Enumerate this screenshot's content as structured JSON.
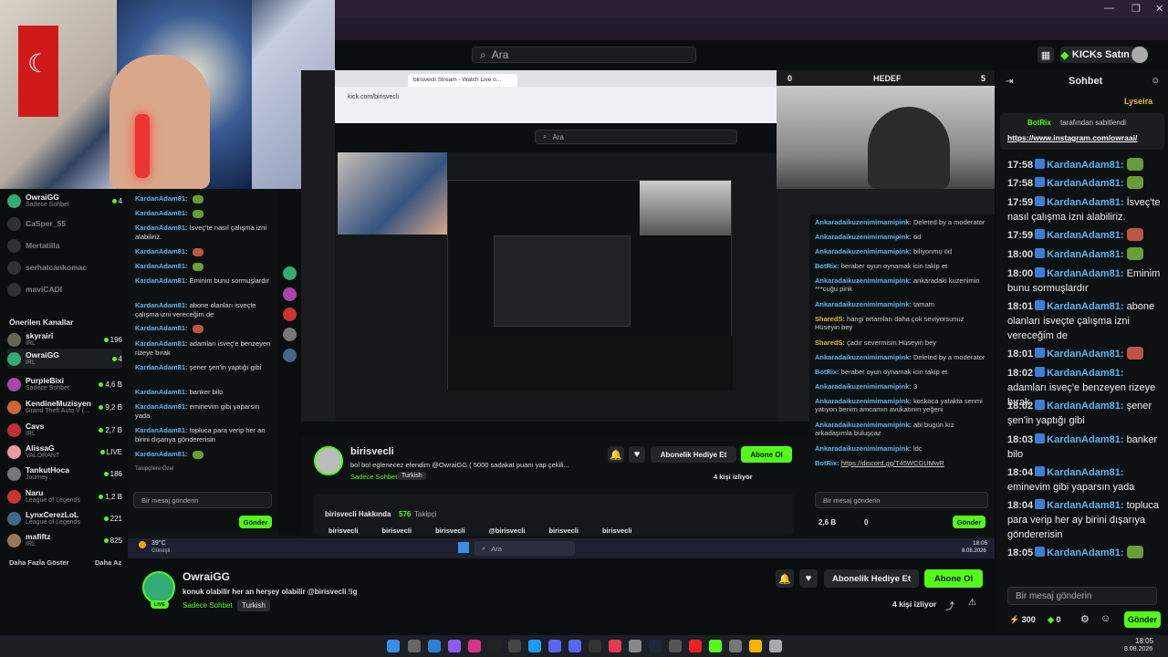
{
  "browser": {
    "search_placeholder": "Ara",
    "kicks_label": "KICKs Satın Al",
    "window_controls": [
      "—",
      "❐",
      "✕"
    ]
  },
  "sidebar": {
    "top_items": [
      {
        "name": "OwraiGG",
        "sub": "Sadece Sohbet",
        "count": "4",
        "live": true
      },
      {
        "name": "CaSper_55",
        "sub": "",
        "count": "",
        "live": false
      },
      {
        "name": "Mertatilla",
        "sub": "",
        "count": "",
        "live": false
      },
      {
        "name": "serhatcankomac",
        "sub": "",
        "count": "",
        "live": false
      },
      {
        "name": "maviCADI",
        "sub": "",
        "count": "",
        "live": false
      }
    ],
    "recommended_title": "Önerilen Kanallar",
    "recommended": [
      {
        "name": "skyrairi",
        "sub": "IRL",
        "count": "196"
      },
      {
        "name": "OwraiGG",
        "sub": "IRL",
        "count": "4"
      },
      {
        "name": "PurpleBixi",
        "sub": "Sadece Sohbet",
        "count": "4,6 B"
      },
      {
        "name": "KendineMuzisyen",
        "sub": "Grand Theft Auto V (...",
        "count": "9,2 B"
      },
      {
        "name": "Cavs",
        "sub": "IRL",
        "count": "2,7 B"
      },
      {
        "name": "AlissaG",
        "sub": "VALORANT",
        "count": "LIVE"
      },
      {
        "name": "TankutHoca",
        "sub": "Journey",
        "count": "186"
      },
      {
        "name": "Naru",
        "sub": "League of Legends",
        "count": "1,2 B"
      },
      {
        "name": "LynxCerezLoL",
        "sub": "League of Legends",
        "count": "221"
      },
      {
        "name": "mafiftz",
        "sub": "IRL",
        "count": "825"
      }
    ],
    "show_more": "Daha Fazla Göster",
    "show_less": "Daha Az"
  },
  "nested_chat": {
    "lines": [
      {
        "user": "KardanAdam81:",
        "text": ""
      },
      {
        "user": "KardanAdam81:",
        "text": ""
      },
      {
        "user": "KardanAdam81:",
        "text": "İsveç'te nasıl çalışma izni alabiliriz."
      },
      {
        "user": "KardanAdam81:",
        "text": ""
      },
      {
        "user": "KardanAdam81:",
        "text": ""
      },
      {
        "user": "KardanAdam81:",
        "text": "Eminim bunu sormuşlardır"
      },
      {
        "user": "KardanAdam81:",
        "text": "abone olanları isveçte çalışma izni vereceğim de"
      },
      {
        "user": "KardanAdam81:",
        "text": ""
      },
      {
        "user": "KardanAdam81:",
        "text": "adamları isveç'e benzeyen rizeye bırak"
      },
      {
        "user": "KardanAdam81:",
        "text": "şener şen'in yaptığı gibi"
      },
      {
        "user": "KardanAdam81:",
        "text": "banker bilo"
      },
      {
        "user": "KardanAdam81:",
        "text": "eminevim gibi yaparsın yada"
      },
      {
        "user": "KardanAdam81:",
        "text": "topluca para verip her an birini dışarıya göndererisin"
      },
      {
        "user": "KardanAdam81:",
        "text": ""
      }
    ],
    "followers_only": "Takipçilere Özel",
    "input_placeholder": "Bir mesaj gönderin",
    "send": "Gönder"
  },
  "mid_stream": {
    "tab1": "birisvecli Stream - Watch Live o...",
    "url": "kick.com/birisvecli",
    "search_placeholder": "Ara",
    "hedef_label": "HEDEF",
    "hedef_left": "0",
    "hedef_right": "5",
    "channel_name": "birisvecli",
    "stream_title": "bol bol eglenecez efendim @OwraiGG ( 5000 sadakat puanı yap çekili...",
    "category": "Sadece Sohbet",
    "tag": "Turkish",
    "gift_sub": "Abonelik Hediye Et",
    "subscribe": "Abone Ol",
    "viewers": "4 kişi izliyor",
    "about": "birisvecli Hakkında",
    "followers_count": "576",
    "followers_label": "Takipçi",
    "socials": [
      "birisvecli",
      "birisvecli",
      "birisvecli",
      "@birisvecli",
      "birisvecli",
      "birisvecli"
    ]
  },
  "mid_chat": {
    "lines": [
      {
        "user": "Ankaradaikuzenimimamipink:",
        "text": "Deleted by a moderator",
        "cls": "b"
      },
      {
        "user": "Ankaradaikuzenimimamipink:",
        "text": "öd",
        "cls": "b"
      },
      {
        "user": "Ankaradaikuzenimimamipink:",
        "text": "biliyonmu öd",
        "cls": "b"
      },
      {
        "user": "BotRix:",
        "text": "beraber oyun oynamak icin takip et",
        "cls": "b"
      },
      {
        "user": "Ankaradaikuzenimimamipink:",
        "text": "ankaradaki kuzenimin ***cuğu pink",
        "cls": "b"
      },
      {
        "user": "Ankaradaikuzenimimamipink:",
        "text": "tamam",
        "cls": "b"
      },
      {
        "user": "SharedS:",
        "text": "hangi ortamları daha çok seviyorsunuz Hüseyin bey",
        "cls": "i"
      },
      {
        "user": "SharedS:",
        "text": "çadır severmisin Hüseyin bey",
        "cls": "i"
      },
      {
        "user": "Ankaradaikuzenimimamipink:",
        "text": "Deleted by a moderator",
        "cls": "b"
      },
      {
        "user": "BotRix:",
        "text": "beraber oyun oynamak icin takip et",
        "cls": "b"
      },
      {
        "user": "Ankaradaikuzenimimamipink:",
        "text": "3",
        "cls": "b"
      },
      {
        "user": "Ankaradaikuzenimimamipink:",
        "text": "koskoca yatakta senmi yatıyon benim amcamın avukatının yeğeni",
        "cls": "b"
      },
      {
        "user": "Ankaradaikuzenimimamipink:",
        "text": "abi bugün kız arkadaşımla buluşcaz",
        "cls": "b"
      },
      {
        "user": "Ankaradaikuzenimimamipink:",
        "text": "ldc",
        "cls": "b"
      },
      {
        "user": "BotRix:",
        "text": "https://discord.gg/T45WCGUMwR",
        "cls": "b"
      }
    ],
    "input_placeholder": "Bir mesaj gönderin",
    "points": "2,6 B",
    "zero": "0",
    "send": "Gönder"
  },
  "inner_taskbar": {
    "weather": "39°C",
    "weather_sub": "Güneşli",
    "search": "Ara",
    "time": "18:05",
    "date": "8.08.2026"
  },
  "main_stream": {
    "channel_name": "OwraiGG",
    "title": "konuk olabilir her an herşey olabilir @birisvecli !ig",
    "category": "Sadece Sohbet",
    "tag": "Turkish",
    "gift_sub": "Abonelik Hediye Et",
    "subscribe": "Abone Ol",
    "viewers": "4 kişi izliyor",
    "live": "LIVE"
  },
  "chat": {
    "title": "Sohbet",
    "top_badge": "Lyseira",
    "pinned_user": "BotRix",
    "pinned_by": "tarafından sabitlendi",
    "pinned_link": "https://www.instagram.com/owraai/",
    "messages": [
      {
        "time": "17:58",
        "user": "KardanAdam81:",
        "text": ""
      },
      {
        "time": "17:58",
        "user": "KardanAdam81:",
        "text": ""
      },
      {
        "time": "17:59",
        "user": "KardanAdam81:",
        "text": "İsveç'te nasıl çalışma izni alabiliriz."
      },
      {
        "time": "17:59",
        "user": "KardanAdam81:",
        "text": ""
      },
      {
        "time": "18:00",
        "user": "KardanAdam81:",
        "text": ""
      },
      {
        "time": "18:00",
        "user": "KardanAdam81:",
        "text": "Eminim bunu sormuşlardır"
      },
      {
        "time": "18:01",
        "user": "KardanAdam81:",
        "text": "abone olanları isveçte çalışma izni vereceğim de"
      },
      {
        "time": "18:01",
        "user": "KardanAdam81:",
        "text": ""
      },
      {
        "time": "18:02",
        "user": "KardanAdam81:",
        "text": "adamları isveç'e benzeyen rizeye bırak"
      },
      {
        "time": "18:02",
        "user": "KardanAdam81:",
        "text": "şener şen'in yaptığı gibi"
      },
      {
        "time": "18:03",
        "user": "KardanAdam81:",
        "text": "banker bilo"
      },
      {
        "time": "18:04",
        "user": "KardanAdam81:",
        "text": "eminevim gibi yaparsın yada"
      },
      {
        "time": "18:04",
        "user": "KardanAdam81:",
        "text": "topluca para verip her ay birini dışarıya göndererisin"
      },
      {
        "time": "18:05",
        "user": "KardanAdam81:",
        "text": ""
      }
    ],
    "input_placeholder": "Bir mesaj gönderin",
    "points": "300",
    "zero": "0",
    "send": "Gönder"
  },
  "taskbar": {
    "time": "18:05",
    "date": "8.08.2026"
  },
  "colors": {
    "kick_green": "#53fc18",
    "username_blue": "#5ab6f5",
    "background": "#0b0e0f"
  }
}
